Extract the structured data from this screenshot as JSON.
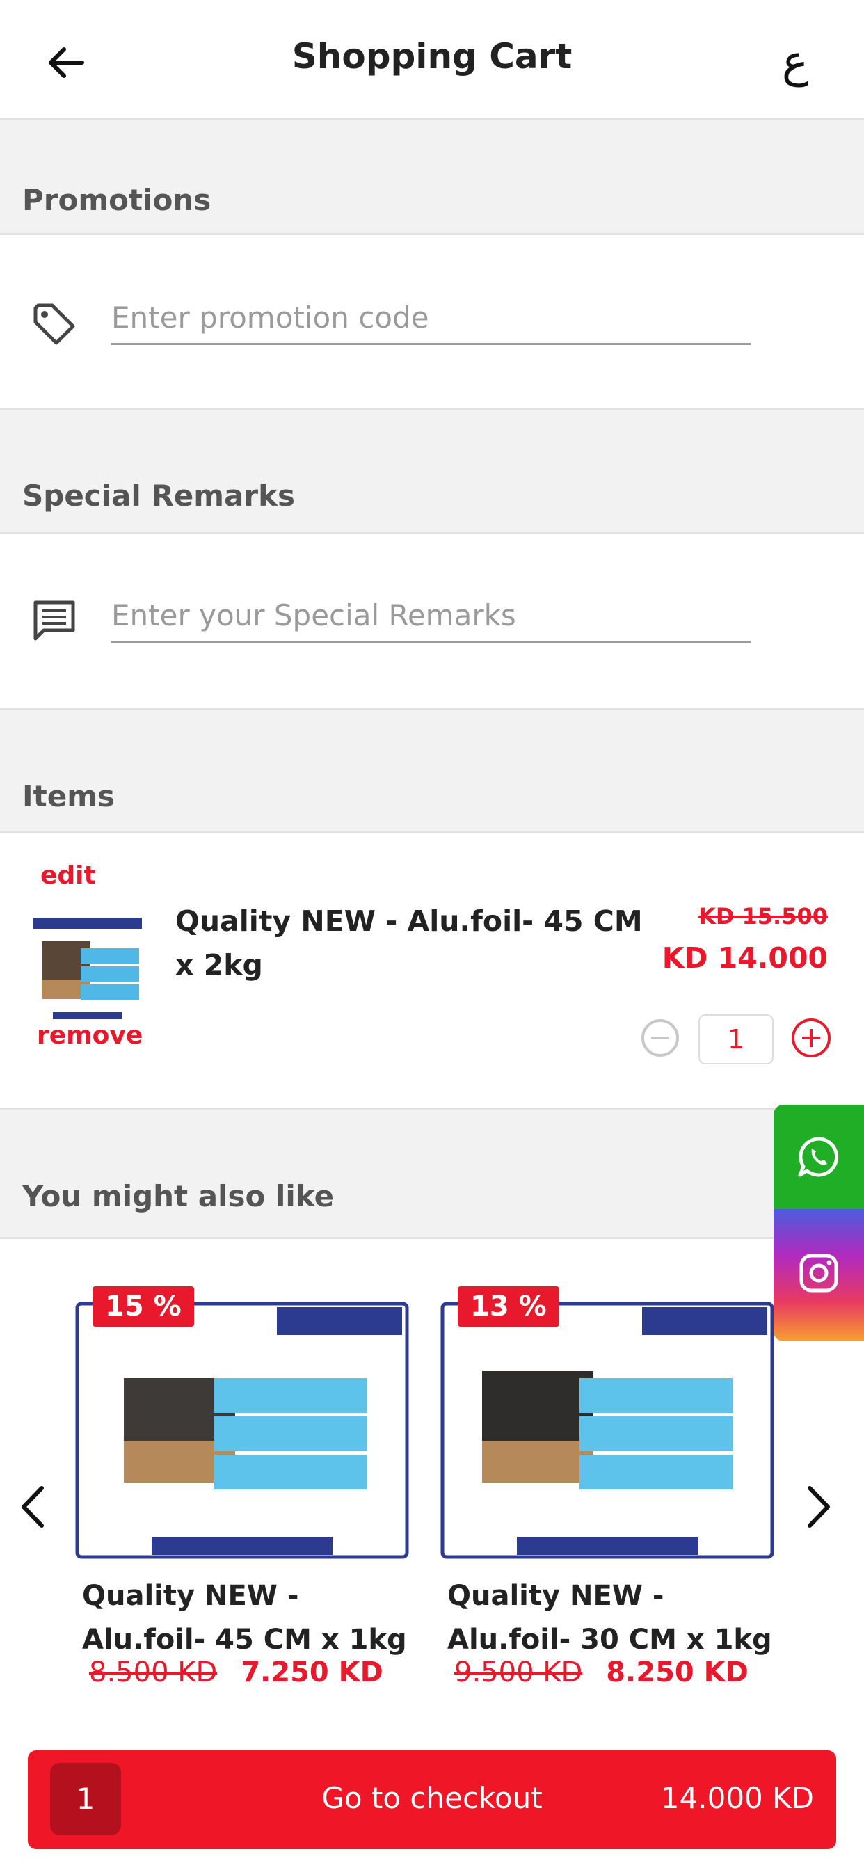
{
  "header": {
    "title": "Shopping Cart",
    "lang_toggle": "ع"
  },
  "promotions": {
    "heading": "Promotions",
    "placeholder": "Enter promotion code"
  },
  "remarks": {
    "heading": "Special Remarks",
    "placeholder": "Enter your Special Remarks"
  },
  "items": {
    "heading": "Items",
    "list": [
      {
        "edit_label": "edit",
        "remove_label": "remove",
        "name": "Quality NEW - Alu.foil- 45 CM x 2kg",
        "old_price": "KD 15.500",
        "price": "KD 14.000",
        "quantity": "1"
      }
    ]
  },
  "recommendations": {
    "heading": "You might also like",
    "products": [
      {
        "discount": "15 %",
        "name": "Quality NEW - Alu.foil- 45 CM x 1kg",
        "old_price": "8.500 KD",
        "price": "7.250 KD"
      },
      {
        "discount": "13 %",
        "name": "Quality NEW - Alu.foil- 30 CM x 1kg",
        "old_price": "9.500 KD",
        "price": "8.250 KD"
      }
    ]
  },
  "checkout": {
    "count": "1",
    "label": "Go to checkout",
    "total": "14.000 KD"
  },
  "colors": {
    "accent": "#e8192c",
    "checkout": "#ef1628",
    "whatsapp": "#1fae25"
  },
  "icons": [
    "back-arrow-icon",
    "tag-icon",
    "comment-icon",
    "minus-circle-icon",
    "plus-circle-icon",
    "chevron-left-icon",
    "chevron-right-icon",
    "whatsapp-icon",
    "instagram-icon"
  ]
}
